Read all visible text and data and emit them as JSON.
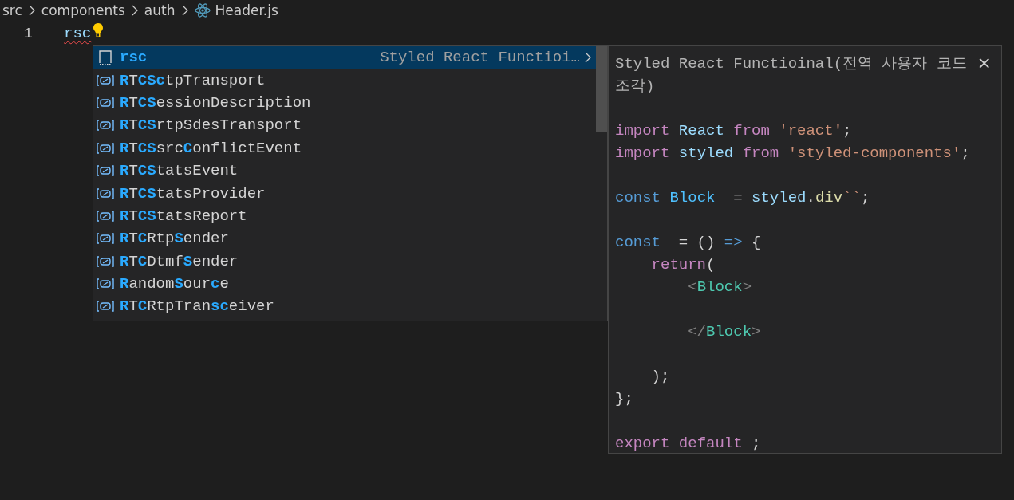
{
  "breadcrumb": [
    {
      "label": "src",
      "kind": "folder"
    },
    {
      "label": "components",
      "kind": "folder"
    },
    {
      "label": "auth",
      "kind": "folder"
    },
    {
      "label": "Header.js",
      "kind": "react-file"
    }
  ],
  "editor": {
    "line_number": "1",
    "typed": "rsc"
  },
  "suggestions": [
    {
      "kind": "snippet",
      "selected": true,
      "segments": [
        {
          "text": "rsc",
          "match": true
        }
      ],
      "detail": "Styled React Functioi…"
    },
    {
      "kind": "variable",
      "selected": false,
      "segments": [
        {
          "text": "R",
          "match": true
        },
        {
          "text": "T",
          "match": false
        },
        {
          "text": "CSc",
          "match": true
        },
        {
          "text": "tpTransport",
          "match": false
        }
      ]
    },
    {
      "kind": "variable",
      "selected": false,
      "segments": [
        {
          "text": "R",
          "match": true
        },
        {
          "text": "T",
          "match": false
        },
        {
          "text": "CS",
          "match": true
        },
        {
          "text": "essionDescription",
          "match": false
        }
      ]
    },
    {
      "kind": "variable",
      "selected": false,
      "segments": [
        {
          "text": "R",
          "match": true
        },
        {
          "text": "T",
          "match": false
        },
        {
          "text": "CS",
          "match": true
        },
        {
          "text": "rtpSdesTransport",
          "match": false
        }
      ]
    },
    {
      "kind": "variable",
      "selected": false,
      "segments": [
        {
          "text": "R",
          "match": true
        },
        {
          "text": "T",
          "match": false
        },
        {
          "text": "CS",
          "match": true
        },
        {
          "text": "src",
          "match": false
        },
        {
          "text": "C",
          "match": true
        },
        {
          "text": "onflictEvent",
          "match": false
        }
      ]
    },
    {
      "kind": "variable",
      "selected": false,
      "segments": [
        {
          "text": "R",
          "match": true
        },
        {
          "text": "T",
          "match": false
        },
        {
          "text": "CS",
          "match": true
        },
        {
          "text": "tatsEvent",
          "match": false
        }
      ]
    },
    {
      "kind": "variable",
      "selected": false,
      "segments": [
        {
          "text": "R",
          "match": true
        },
        {
          "text": "T",
          "match": false
        },
        {
          "text": "CS",
          "match": true
        },
        {
          "text": "tatsProvider",
          "match": false
        }
      ]
    },
    {
      "kind": "variable",
      "selected": false,
      "segments": [
        {
          "text": "R",
          "match": true
        },
        {
          "text": "T",
          "match": false
        },
        {
          "text": "CS",
          "match": true
        },
        {
          "text": "tatsReport",
          "match": false
        }
      ]
    },
    {
      "kind": "variable",
      "selected": false,
      "segments": [
        {
          "text": "R",
          "match": true
        },
        {
          "text": "T",
          "match": false
        },
        {
          "text": "C",
          "match": true
        },
        {
          "text": "Rtp",
          "match": false
        },
        {
          "text": "S",
          "match": true
        },
        {
          "text": "ender",
          "match": false
        }
      ]
    },
    {
      "kind": "variable",
      "selected": false,
      "segments": [
        {
          "text": "R",
          "match": true
        },
        {
          "text": "T",
          "match": false
        },
        {
          "text": "C",
          "match": true
        },
        {
          "text": "Dtmf",
          "match": false
        },
        {
          "text": "S",
          "match": true
        },
        {
          "text": "ender",
          "match": false
        }
      ]
    },
    {
      "kind": "variable",
      "selected": false,
      "segments": [
        {
          "text": "R",
          "match": true
        },
        {
          "text": "andom",
          "match": false
        },
        {
          "text": "S",
          "match": true
        },
        {
          "text": "our",
          "match": false
        },
        {
          "text": "c",
          "match": true
        },
        {
          "text": "e",
          "match": false
        }
      ]
    },
    {
      "kind": "variable",
      "selected": false,
      "segments": [
        {
          "text": "R",
          "match": true
        },
        {
          "text": "T",
          "match": false
        },
        {
          "text": "C",
          "match": true
        },
        {
          "text": "RtpTran",
          "match": false
        },
        {
          "text": "sc",
          "match": true
        },
        {
          "text": "eiver",
          "match": false
        }
      ]
    }
  ],
  "details": {
    "title": "Styled React Functioinal(전역 사용자 코드 조각)",
    "close": "×",
    "code": [
      {
        "blank_before": true,
        "tokens": [
          {
            "text": "import ",
            "kind": "keyword"
          },
          {
            "text": "React ",
            "kind": "variable"
          },
          {
            "text": "from ",
            "kind": "keyword"
          },
          {
            "text": "'react'",
            "kind": "string"
          },
          {
            "text": ";",
            "kind": "plain"
          }
        ]
      },
      {
        "blank_before": false,
        "tokens": [
          {
            "text": "import ",
            "kind": "keyword"
          },
          {
            "text": "styled ",
            "kind": "variable"
          },
          {
            "text": "from ",
            "kind": "keyword"
          },
          {
            "text": "'styled-components'",
            "kind": "string"
          },
          {
            "text": ";",
            "kind": "plain"
          }
        ]
      },
      {
        "blank_before": true,
        "tokens": [
          {
            "text": "const ",
            "kind": "storage"
          },
          {
            "text": "Block",
            "kind": "constant"
          },
          {
            "text": "  = ",
            "kind": "plain"
          },
          {
            "text": "styled",
            "kind": "variable"
          },
          {
            "text": ".",
            "kind": "plain"
          },
          {
            "text": "div",
            "kind": "function"
          },
          {
            "text": "``",
            "kind": "string"
          },
          {
            "text": ";",
            "kind": "plain"
          }
        ]
      },
      {
        "blank_before": true,
        "tokens": [
          {
            "text": "const",
            "kind": "storage"
          },
          {
            "text": "  = () ",
            "kind": "plain"
          },
          {
            "text": "=>",
            "kind": "storage"
          },
          {
            "text": " {",
            "kind": "plain"
          }
        ]
      },
      {
        "blank_before": false,
        "tokens": [
          {
            "text": "    return",
            "kind": "keyword"
          },
          {
            "text": "(",
            "kind": "plain"
          }
        ]
      },
      {
        "blank_before": false,
        "tokens": [
          {
            "text": "        <",
            "kind": "punct"
          },
          {
            "text": "Block",
            "kind": "tag"
          },
          {
            "text": ">",
            "kind": "punct"
          }
        ]
      },
      {
        "blank_before": true,
        "tokens": [
          {
            "text": "        </",
            "kind": "punct"
          },
          {
            "text": "Block",
            "kind": "tag"
          },
          {
            "text": ">",
            "kind": "punct"
          }
        ]
      },
      {
        "blank_before": true,
        "tokens": [
          {
            "text": "    );",
            "kind": "plain"
          }
        ]
      },
      {
        "blank_before": false,
        "tokens": [
          {
            "text": "};",
            "kind": "plain"
          }
        ]
      },
      {
        "blank_before": true,
        "tokens": [
          {
            "text": "export ",
            "kind": "keyword"
          },
          {
            "text": "default ",
            "kind": "keyword"
          },
          {
            "text": ";",
            "kind": "plain"
          }
        ]
      }
    ]
  }
}
